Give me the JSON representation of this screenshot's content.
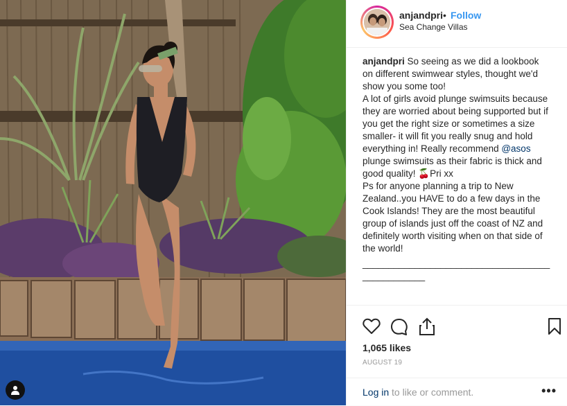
{
  "header": {
    "username": "anjandpri",
    "separator": "•",
    "follow_label": "Follow",
    "location": "Sea Change Villas"
  },
  "caption": {
    "username": "anjandpri",
    "para1": " So seeing as we did a lookbook on different swimwear styles, thought we'd show you some too!",
    "para2_a": "A lot of girls avoid plunge swimsuits because they are worried about being supported but if you get the right size or sometimes a size smaller- it will fit you really snug and hold everything in! Really recommend ",
    "mention": "@asos",
    "para2_b": " plunge swimsuits as their fabric is thick and good quality! 🍒Pri xx",
    "para3": "Ps for anyone planning a trip to New Zealand..you HAVE to do a few days in the Cook Islands! They are the most beautiful group of islands just off the coast of NZ and definitely worth visiting when on that side of the world!",
    "divider": "________________________________________________"
  },
  "actions": {
    "likes": "1,065 likes",
    "date": "AUGUST 19"
  },
  "comment": {
    "login_link": "Log in",
    "login_rest": " to like or comment.",
    "more": "•••"
  },
  "icons": {
    "like": "heart-icon",
    "comment": "comment-icon",
    "share": "share-icon",
    "save": "bookmark-icon",
    "tag": "user-tag-icon"
  },
  "colors": {
    "follow": "#3897f0",
    "mention": "#003569",
    "pool": "#1f4fa0"
  }
}
